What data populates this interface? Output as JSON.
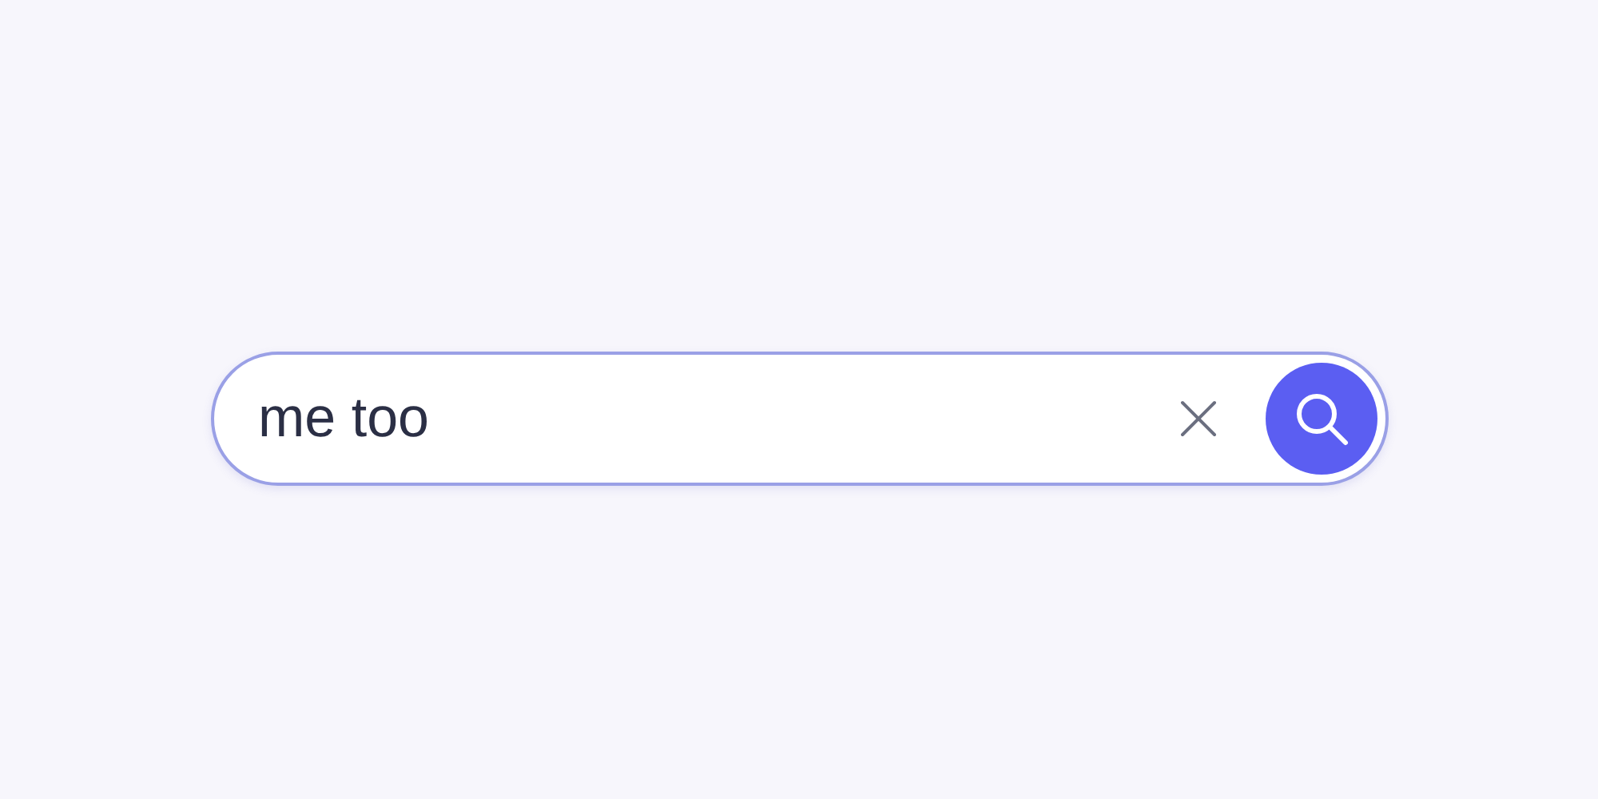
{
  "search": {
    "value": "me too"
  }
}
